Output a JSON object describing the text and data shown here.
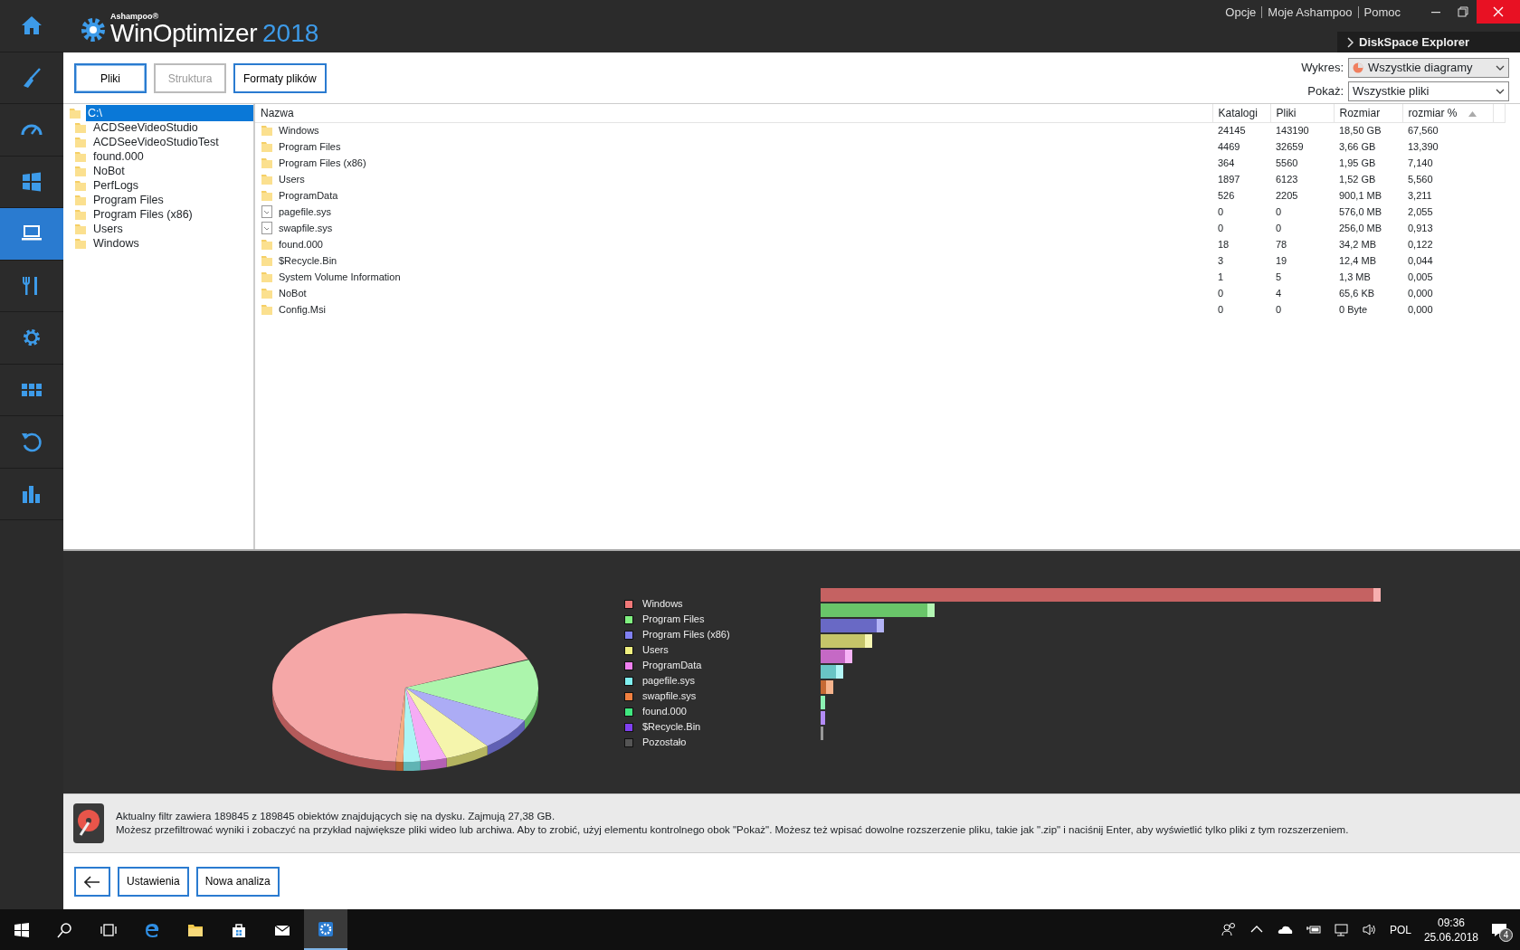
{
  "window": {
    "brand": "Ashampoo®",
    "title": "WinOptimizer",
    "version": "2018",
    "menu": [
      {
        "label": "Opcje"
      },
      {
        "label": "Moje Ashampoo"
      },
      {
        "label": "Pomoc"
      }
    ],
    "section": "DiskSpace Explorer"
  },
  "sidebar": {
    "items": [
      {
        "selected": false
      },
      {
        "selected": false
      },
      {
        "selected": false
      },
      {
        "selected": false
      },
      {
        "selected": true
      },
      {
        "selected": false
      },
      {
        "selected": false
      },
      {
        "selected": false
      },
      {
        "selected": false
      },
      {
        "selected": false
      }
    ]
  },
  "tabs": [
    {
      "label": "Pliki",
      "selected": true,
      "disabled": false
    },
    {
      "label": "Struktura",
      "selected": false,
      "disabled": true
    },
    {
      "label": "Formaty plików",
      "selected": false,
      "disabled": false
    }
  ],
  "filters": [
    {
      "label": "Wykres:",
      "value": "Wszystkie diagramy",
      "kind": "chart"
    },
    {
      "label": "Pokaż:",
      "value": "Wszystkie pliki",
      "kind": "plain"
    }
  ],
  "tree": [
    {
      "label": "C:\\",
      "selected": true,
      "children": [
        {
          "label": "ACDSeeVideoStudio",
          "selected": false
        },
        {
          "label": "ACDSeeVideoStudioTest",
          "selected": false
        },
        {
          "label": "found.000",
          "selected": false
        },
        {
          "label": "NoBot",
          "selected": false
        },
        {
          "label": "PerfLogs",
          "selected": false
        },
        {
          "label": "Program Files",
          "selected": false
        },
        {
          "label": "Program Files (x86)",
          "selected": false
        },
        {
          "label": "Users",
          "selected": false
        },
        {
          "label": "Windows",
          "selected": false
        }
      ]
    }
  ],
  "table": {
    "columns": [
      {
        "label": "Nazwa",
        "sorted": false
      },
      {
        "label": "Katalogi",
        "sorted": false
      },
      {
        "label": "Pliki",
        "sorted": false
      },
      {
        "label": "Rozmiar",
        "sorted": false
      },
      {
        "label": "rozmiar %",
        "sorted": true
      }
    ],
    "rows": [
      {
        "kind": "folder",
        "cells": [
          "Windows",
          "24145",
          "143190",
          "18,50 GB",
          "67,560"
        ]
      },
      {
        "kind": "folder",
        "cells": [
          "Program Files",
          "4469",
          "32659",
          "3,66 GB",
          "13,390"
        ]
      },
      {
        "kind": "folder",
        "cells": [
          "Program Files (x86)",
          "364",
          "5560",
          "1,95 GB",
          "7,140"
        ]
      },
      {
        "kind": "folder",
        "cells": [
          "Users",
          "1897",
          "6123",
          "1,52 GB",
          "5,560"
        ]
      },
      {
        "kind": "folder",
        "cells": [
          "ProgramData",
          "526",
          "2205",
          "900,1 MB",
          "3,211"
        ]
      },
      {
        "kind": "file",
        "cells": [
          "pagefile.sys",
          "0",
          "0",
          "576,0 MB",
          "2,055"
        ]
      },
      {
        "kind": "file",
        "cells": [
          "swapfile.sys",
          "0",
          "0",
          "256,0 MB",
          "0,913"
        ]
      },
      {
        "kind": "folder",
        "cells": [
          "found.000",
          "18",
          "78",
          "34,2 MB",
          "0,122"
        ]
      },
      {
        "kind": "folder",
        "cells": [
          "$Recycle.Bin",
          "3",
          "19",
          "12,4 MB",
          "0,044"
        ]
      },
      {
        "kind": "folder",
        "cells": [
          "System Volume Information",
          "1",
          "5",
          "1,3 MB",
          "0,005"
        ]
      },
      {
        "kind": "folder",
        "cells": [
          "NoBot",
          "0",
          "4",
          "65,6 KB",
          "0,000"
        ]
      },
      {
        "kind": "folder",
        "cells": [
          "Config.Msi",
          "0",
          "0",
          "0 Byte",
          "0,000"
        ]
      }
    ]
  },
  "chart_legend": [
    {
      "label": "Windows",
      "color": "#f07878"
    },
    {
      "label": "Program Files",
      "color": "#80f080"
    },
    {
      "label": "Program Files (x86)",
      "color": "#8080f0"
    },
    {
      "label": "Users",
      "color": "#f0f080"
    },
    {
      "label": "ProgramData",
      "color": "#f080f0"
    },
    {
      "label": "pagefile.sys",
      "color": "#80f0f0"
    },
    {
      "label": "swapfile.sys",
      "color": "#f08040"
    },
    {
      "label": "found.000",
      "color": "#40e880"
    },
    {
      "label": "$Recycle.Bin",
      "color": "#8040f0"
    },
    {
      "label": "Pozostało",
      "color": "#555555"
    }
  ],
  "info": {
    "lines": [
      "Aktualny filtr zawiera 189845 z 189845 obiektów znajdujących się na dysku. Zajmują 27,38 GB.",
      "Możesz przefiltrować wyniki i zobaczyć na przykład największe pliki wideo lub archiwa. Aby to zrobić, użyj elementu kontrolnego obok \"Pokaż\". Możesz też wpisać dowolne rozszerzenie pliku, takie jak \".zip\" i naciśnij Enter, aby wyświetlić tylko pliki z tym rozszerzeniem."
    ]
  },
  "buttons": [
    {
      "kind": "back"
    },
    {
      "kind": "text",
      "label": "Ustawienia"
    },
    {
      "kind": "text",
      "label": "Nowa analiza"
    }
  ],
  "taskbar": {
    "apps": [
      {
        "selected": false
      },
      {
        "selected": false
      },
      {
        "selected": false
      },
      {
        "selected": false
      },
      {
        "selected": false
      },
      {
        "selected": false
      },
      {
        "selected": false
      },
      {
        "selected": true
      }
    ],
    "language": "POL",
    "time": "09:36",
    "date": "25.06.2018",
    "notifications": "4"
  }
}
